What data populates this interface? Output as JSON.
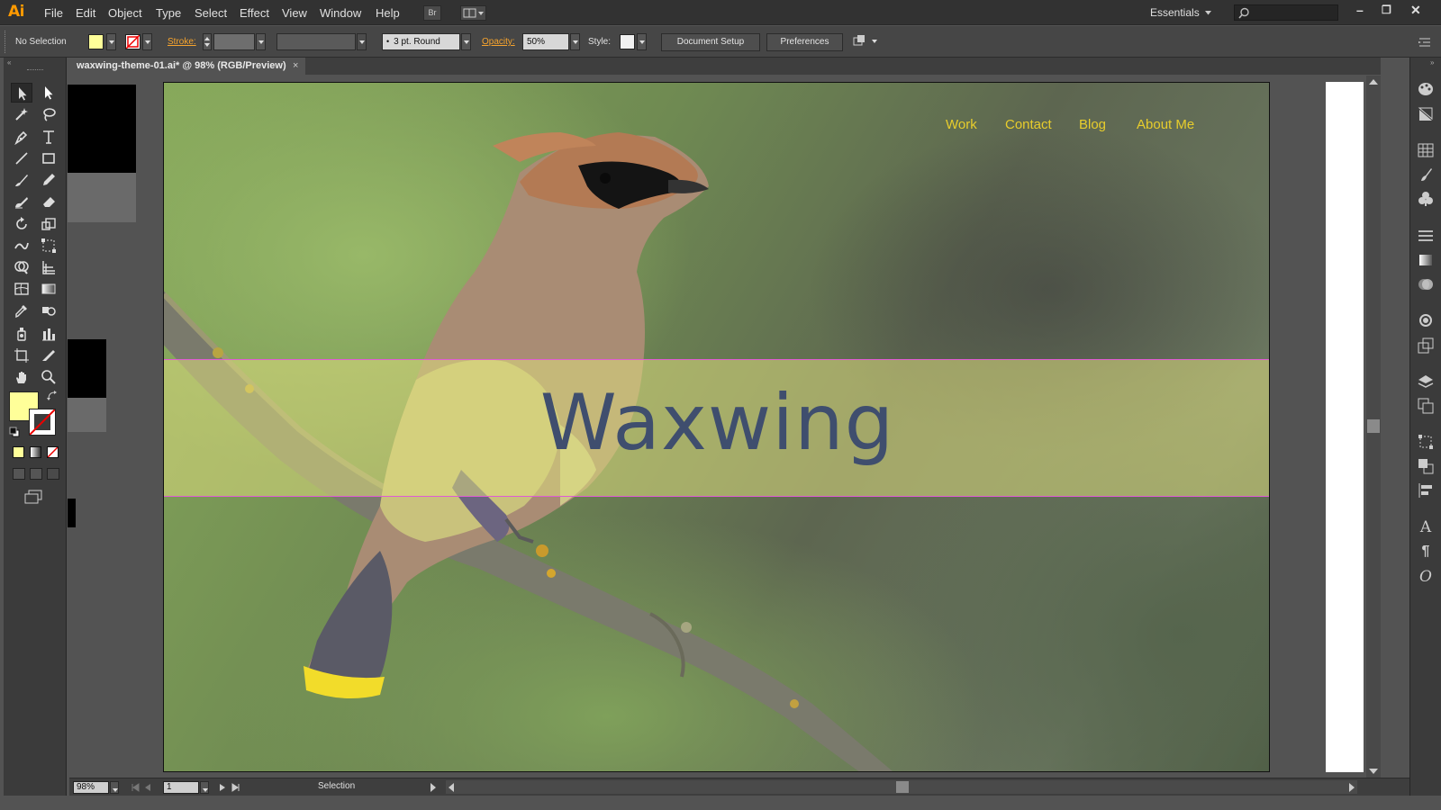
{
  "app": {
    "logo": "Ai"
  },
  "menu": [
    "File",
    "Edit",
    "Object",
    "Type",
    "Select",
    "Effect",
    "View",
    "Window",
    "Help"
  ],
  "menubar": {
    "bridge_label": "Br",
    "workspace": "Essentials"
  },
  "control_bar": {
    "selection": "No Selection",
    "stroke_label": "Stroke:",
    "brush": "3 pt. Round",
    "opacity_label": "Opacity:",
    "opacity_value": "50%",
    "style_label": "Style:",
    "document_setup": "Document Setup",
    "preferences": "Preferences",
    "fill_color": "#ffff99"
  },
  "document": {
    "tab_title": "waxwing-theme-01.ai* @ 98% (RGB/Preview)",
    "close": "×"
  },
  "artboard": {
    "title": "Waxwing",
    "nav": [
      "Work",
      "Contact",
      "Blog",
      "About Me"
    ]
  },
  "status": {
    "zoom": "98%",
    "page": "1",
    "tool": "Selection"
  },
  "colors": {
    "accent": "#ff9a00",
    "nav": "#e8cd2c",
    "title": "#3f4e6e",
    "band": "#dddc7e",
    "guide": "#e05bd4"
  },
  "icons": [
    "selection-tool-icon",
    "direct-selection-tool-icon",
    "magic-wand-icon",
    "lasso-icon",
    "pen-tool-icon",
    "type-tool-icon",
    "line-tool-icon",
    "rectangle-tool-icon",
    "paintbrush-icon",
    "pencil-icon",
    "blob-brush-icon",
    "eraser-icon",
    "rotate-icon",
    "scale-icon",
    "warp-icon",
    "free-transform-icon",
    "shape-builder-icon",
    "perspective-grid-icon",
    "mesh-icon",
    "gradient-icon",
    "eyedropper-icon",
    "blend-icon",
    "symbol-sprayer-icon",
    "graph-icon",
    "artboard-tool-icon",
    "slice-icon",
    "hand-icon",
    "zoom-icon"
  ]
}
